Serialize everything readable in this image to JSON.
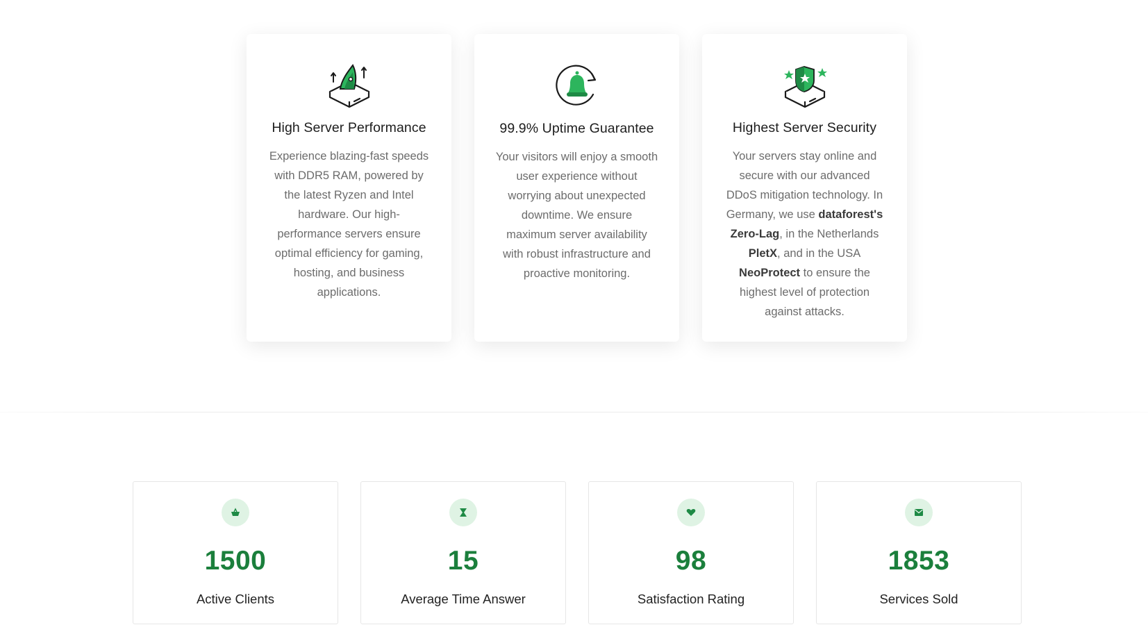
{
  "features": [
    {
      "title": "High Server Performance",
      "icon": "server-rocket-icon",
      "description_parts": [
        {
          "text": "Experience blazing-fast speeds with DDR5 RAM, powered by the latest Ryzen and Intel hardware. Our high-performance servers ensure optimal efficiency for gaming, hosting, and business applications.",
          "bold": false
        }
      ]
    },
    {
      "title": "99.9% Uptime Guarantee",
      "icon": "bell-refresh-icon",
      "description_parts": [
        {
          "text": "Your visitors will enjoy a smooth user experience without worrying about unexpected downtime. We ensure maximum server availability with robust infrastructure and proactive monitoring.",
          "bold": false
        }
      ]
    },
    {
      "title": "Highest Server Security",
      "icon": "server-shield-icon",
      "description_parts": [
        {
          "text": "Your servers stay online and secure with our advanced DDoS mitigation technology. In Germany, we use ",
          "bold": false
        },
        {
          "text": "dataforest's Zero-Lag",
          "bold": true
        },
        {
          "text": ", in the Netherlands ",
          "bold": false
        },
        {
          "text": "PletX",
          "bold": true
        },
        {
          "text": ", and in the USA ",
          "bold": false
        },
        {
          "text": "NeoProtect",
          "bold": true
        },
        {
          "text": " to ensure the highest level of protection against attacks.",
          "bold": false
        }
      ]
    }
  ],
  "stats": [
    {
      "value": "1500",
      "label": "Active Clients",
      "icon": "basket-icon"
    },
    {
      "value": "15",
      "label": "Average Time Answer",
      "icon": "hourglass-icon"
    },
    {
      "value": "98",
      "label": "Satisfaction Rating",
      "icon": "heart-icon"
    },
    {
      "value": "1853",
      "label": "Services Sold",
      "icon": "envelope-icon"
    }
  ],
  "colors": {
    "accent": "#1b7f3c",
    "icon_green": "#2db55d",
    "icon_bg": "#dff3e4"
  }
}
